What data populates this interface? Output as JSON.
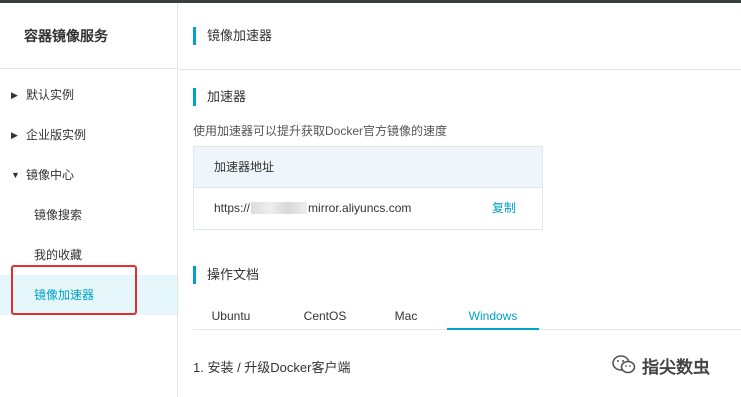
{
  "sidebar": {
    "title": "容器镜像服务",
    "groups": [
      {
        "label": "默认实例",
        "arrow": "▶"
      },
      {
        "label": "企业版实例",
        "arrow": "▶"
      },
      {
        "label": "镜像中心",
        "arrow": "▼"
      }
    ],
    "sub_items": [
      {
        "label": "镜像搜索"
      },
      {
        "label": "我的收藏"
      },
      {
        "label": "镜像加速器"
      }
    ]
  },
  "header": {
    "title": "镜像加速器"
  },
  "accelerator": {
    "section_title": "加速器",
    "description": "使用加速器可以提升获取Docker官方镜像的速度",
    "table_header": "加速器地址",
    "address_prefix": "https://",
    "address_suffix": "mirror.aliyuncs.com",
    "copy_label": "复制"
  },
  "docs": {
    "section_title": "操作文档",
    "tabs": [
      {
        "label": "Ubuntu"
      },
      {
        "label": "CentOS"
      },
      {
        "label": "Mac"
      },
      {
        "label": "Windows"
      }
    ],
    "active_tab": "Windows",
    "step_1": "1. 安装 / 升级Docker客户端"
  },
  "watermark": {
    "text": "指尖数虫"
  },
  "colors": {
    "accent": "#00a2ca",
    "highlight_border": "#e22e2e",
    "active_bg": "#e5f7fb"
  }
}
